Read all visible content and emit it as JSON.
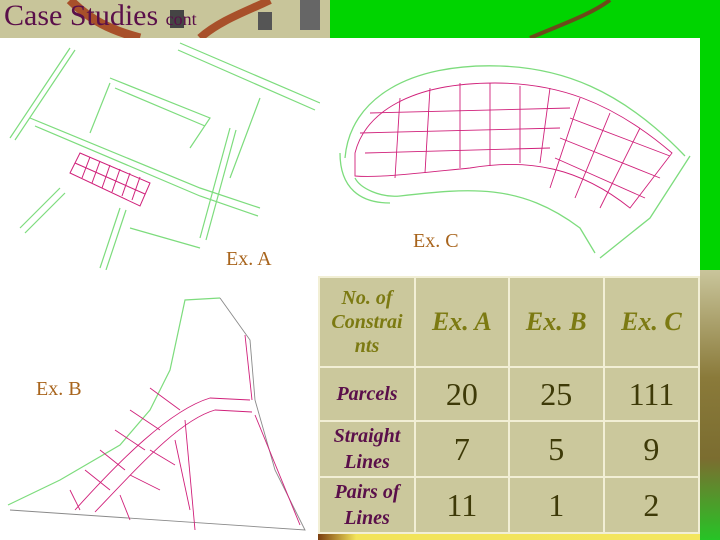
{
  "slide": {
    "title": "Case Studies",
    "title_suffix": "cont"
  },
  "figures": {
    "ex_a_label": "Ex. A",
    "ex_b_label": "Ex. B",
    "ex_c_label": "Ex. C"
  },
  "table": {
    "header": [
      "No. of Constraints",
      "Ex. A",
      "Ex. B",
      "Ex. C"
    ],
    "header_first_lines": [
      "No. of",
      "Constrai",
      "nts"
    ],
    "rows": [
      {
        "label_lines": [
          "Parcels"
        ],
        "values": [
          "20",
          "25",
          "111"
        ]
      },
      {
        "label_lines": [
          "Straight",
          "Lines"
        ],
        "values": [
          "7",
          "5",
          "9"
        ]
      },
      {
        "label_lines": [
          "Pairs of",
          "Lines"
        ],
        "values": [
          "11",
          "1",
          "2"
        ]
      }
    ]
  },
  "colors": {
    "title": "#5a0f4a",
    "figure_label": "#a8641c",
    "table_bg": "#cbc89c",
    "header_text": "#7c7a12",
    "row_label_text": "#5a0f4a",
    "value_text": "#3e3a08",
    "green_bg": "#00d400",
    "road_green": "#66d966",
    "parcel_pink": "#d0207a"
  }
}
